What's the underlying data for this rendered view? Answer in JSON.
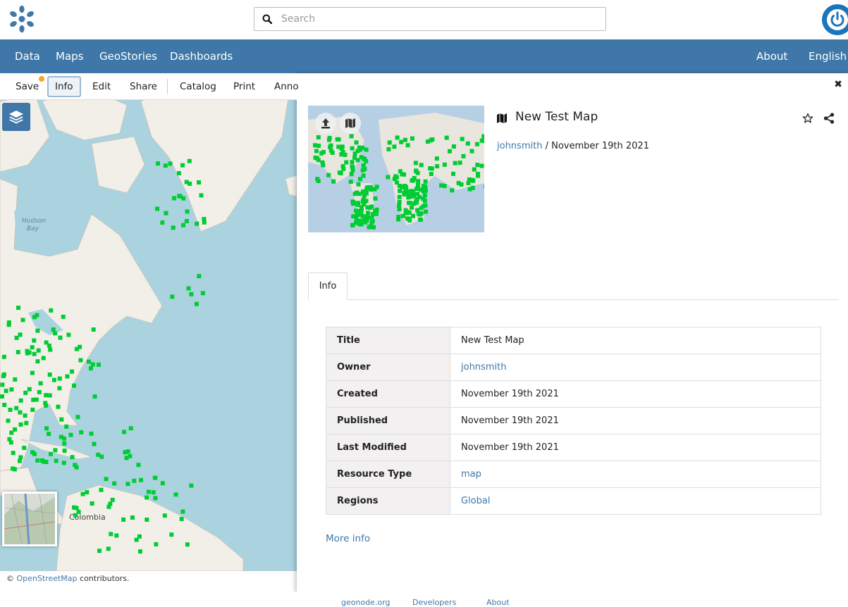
{
  "header": {
    "search_placeholder": "Search",
    "icons": {
      "logo": "geonode-logo-icon",
      "search": "search-icon",
      "user": "power-icon"
    }
  },
  "nav": {
    "items": [
      "Data",
      "Maps",
      "GeoStories",
      "Dashboards"
    ],
    "right_items": [
      "About",
      "English"
    ]
  },
  "toolbar": {
    "items": [
      "Save",
      "Info",
      "Edit",
      "Share",
      "Catalog",
      "Print",
      "Anno"
    ],
    "active": "Info"
  },
  "map": {
    "labels": {
      "hudson": "Hudson\nBay",
      "colombia": "Colombia"
    },
    "attribution_prefix": "©",
    "attribution_link": "OpenStreetMap",
    "attribution_suffix": "contributors."
  },
  "panel": {
    "title": "New Test Map",
    "owner": "johnsmith",
    "separator": "/",
    "date": "November 19th 2021",
    "tab_label": "Info",
    "table": [
      {
        "key": "Title",
        "value": "New Test Map",
        "link": false
      },
      {
        "key": "Owner",
        "value": "johnsmith",
        "link": true
      },
      {
        "key": "Created",
        "value": "November 19th 2021",
        "link": false
      },
      {
        "key": "Published",
        "value": "November 19th 2021",
        "link": false
      },
      {
        "key": "Last Modified",
        "value": "November 19th 2021",
        "link": false
      },
      {
        "key": "Resource Type",
        "value": "map",
        "link": true
      },
      {
        "key": "Regions",
        "value": "Global",
        "link": true
      }
    ],
    "more_info": "More info",
    "close": "✖"
  },
  "footer": {
    "links": [
      "geonode.org",
      "Developers",
      "About"
    ]
  },
  "colors": {
    "brand": "#3f78a8",
    "point": "#00cc33",
    "water": "#aad3df",
    "land": "#f2efe9"
  }
}
